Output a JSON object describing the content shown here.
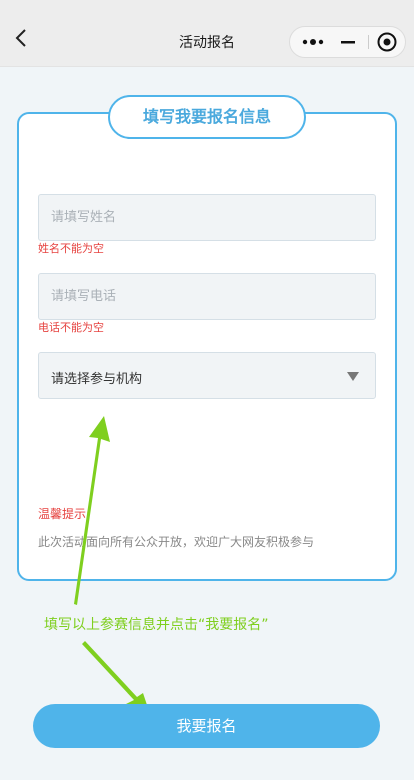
{
  "navbar": {
    "title": "活动报名"
  },
  "form": {
    "heading": "填写我要报名信息",
    "name_placeholder": "请填写姓名",
    "name_error": "姓名不能为空",
    "phone_placeholder": "请填写电话",
    "phone_error": "电话不能为空",
    "org_select": "请选择参与机构",
    "tip_title": "温馨提示:",
    "tip_text": "此次活动面向所有公众开放，欢迎广大网友积极参与"
  },
  "annotation": "填写以上参赛信息并点击“我要报名”",
  "submit_label": "我要报名",
  "colors": {
    "accent": "#4fb4ea",
    "error": "#e64340",
    "annotation": "#7fcf1f"
  }
}
